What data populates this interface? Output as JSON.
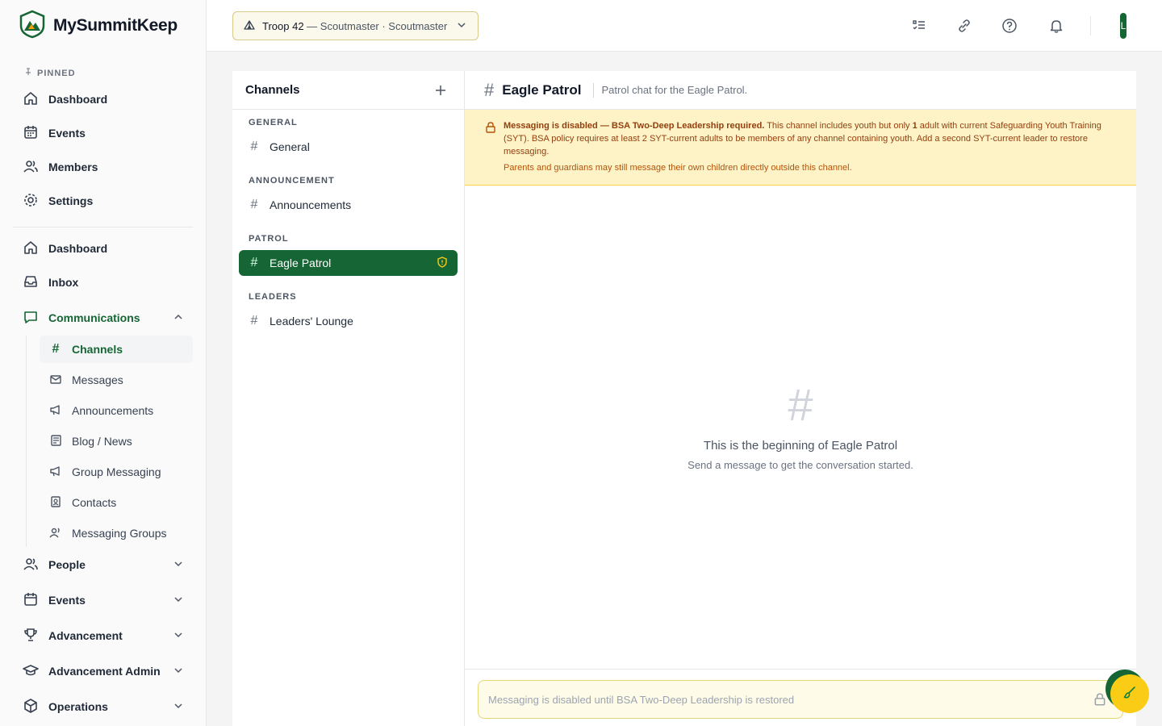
{
  "brand": {
    "name": "MySummitKeep"
  },
  "sidebar": {
    "pinned_label": "PINNED",
    "pinned": [
      {
        "label": "Dashboard",
        "icon": "home-icon"
      },
      {
        "label": "Events",
        "icon": "calendar-icon"
      },
      {
        "label": "Members",
        "icon": "users-icon"
      },
      {
        "label": "Settings",
        "icon": "gear-icon"
      }
    ],
    "main": [
      {
        "label": "Dashboard",
        "icon": "home-icon"
      },
      {
        "label": "Inbox",
        "icon": "inbox-icon"
      }
    ],
    "communications": {
      "label": "Communications",
      "expanded": true,
      "items": [
        {
          "label": "Channels",
          "icon": "hash-icon",
          "active": true
        },
        {
          "label": "Messages",
          "icon": "mail-icon"
        },
        {
          "label": "Announcements",
          "icon": "megaphone-icon"
        },
        {
          "label": "Blog / News",
          "icon": "newspaper-icon"
        },
        {
          "label": "Group Messaging",
          "icon": "megaphone-icon"
        },
        {
          "label": "Contacts",
          "icon": "contact-icon"
        },
        {
          "label": "Messaging Groups",
          "icon": "users-icon"
        }
      ]
    },
    "collapsed": [
      {
        "label": "People",
        "icon": "users-icon"
      },
      {
        "label": "Events",
        "icon": "calendar-icon"
      },
      {
        "label": "Advancement",
        "icon": "trophy-icon"
      },
      {
        "label": "Advancement Admin",
        "icon": "graduation-icon"
      },
      {
        "label": "Operations",
        "icon": "box-icon"
      }
    ]
  },
  "topbar": {
    "troop_primary": "Troop 42",
    "troop_secondary": " — Scoutmaster · Scoutmaster",
    "avatar_initial": "L"
  },
  "channels": {
    "title": "Channels",
    "groups": [
      {
        "label": "GENERAL",
        "channels": [
          {
            "name": "General"
          }
        ]
      },
      {
        "label": "ANNOUNCEMENT",
        "channels": [
          {
            "name": "Announcements"
          }
        ]
      },
      {
        "label": "PATROL",
        "channels": [
          {
            "name": "Eagle Patrol",
            "active": true
          }
        ]
      },
      {
        "label": "LEADERS",
        "channels": [
          {
            "name": "Leaders' Lounge"
          }
        ]
      }
    ]
  },
  "chat": {
    "title": "Eagle Patrol",
    "description": "Patrol chat for the Eagle Patrol.",
    "warning": {
      "bold": "Messaging is disabled — BSA Two-Deep Leadership required.",
      "text_a": " This channel includes youth but only ",
      "count": "1",
      "text_b": " adult with current Safeguarding Youth Training (SYT). BSA policy requires at least 2 SYT-current adults to be members of any channel containing youth. Add a second SYT-current leader to restore messaging.",
      "sub": "Parents and guardians may still message their own children directly outside this channel."
    },
    "empty_title": "This is the beginning of Eagle Patrol",
    "empty_sub": "Send a message to get the conversation started.",
    "composer_placeholder": "Messaging is disabled until BSA Two-Deep Leadership is restored"
  },
  "colors": {
    "primary": "#166534",
    "warning_bg": "#fef3c7",
    "warning_text": "#92400e",
    "fab": "#facc15"
  }
}
